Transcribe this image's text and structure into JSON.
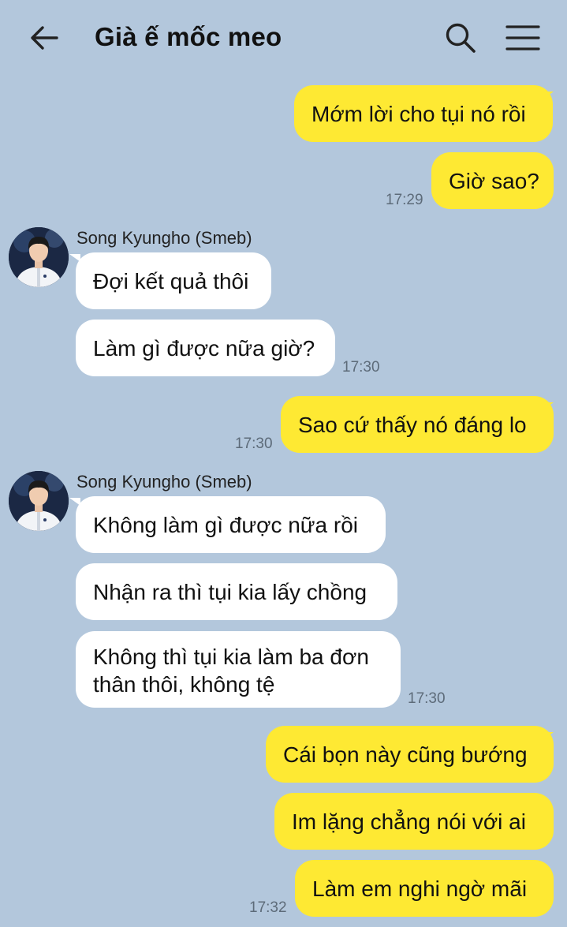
{
  "header": {
    "title": "Già ế mốc meo",
    "back_icon": "arrow-left-icon",
    "search_icon": "search-icon",
    "menu_icon": "hamburger-menu-icon"
  },
  "colors": {
    "background": "#b3c7dc",
    "my_bubble": "#fee933",
    "their_bubble": "#ffffff",
    "timestamp": "#5d6b79"
  },
  "messages": [
    {
      "from": "me",
      "text": "Mớm lời cho tụi nó rồi",
      "time": ""
    },
    {
      "from": "me",
      "text": "Giờ sao?",
      "time": "17:29"
    },
    {
      "from": "Song Kyungho (Smeb)",
      "text": "Đợi kết quả thôi",
      "time": ""
    },
    {
      "from": "Song Kyungho (Smeb)",
      "text": "Làm gì được nữa giờ?",
      "time": "17:30"
    },
    {
      "from": "me",
      "text": "Sao cứ thấy nó đáng lo",
      "time": "17:30"
    },
    {
      "from": "Song Kyungho (Smeb)",
      "text": "Không làm gì được nữa rồi",
      "time": ""
    },
    {
      "from": "Song Kyungho (Smeb)",
      "text": "Nhận ra thì tụi kia lấy chồng",
      "time": ""
    },
    {
      "from": "Song Kyungho (Smeb)",
      "text": "Không thì tụi kia làm ba đơn thân thôi, không tệ",
      "time": "17:30"
    },
    {
      "from": "me",
      "text": "Cái bọn này cũng bướng",
      "time": ""
    },
    {
      "from": "me",
      "text": "Im lặng chẳng nói với ai",
      "time": ""
    },
    {
      "from": "me",
      "text": "Làm em nghi ngờ mãi",
      "time": "17:32"
    }
  ]
}
